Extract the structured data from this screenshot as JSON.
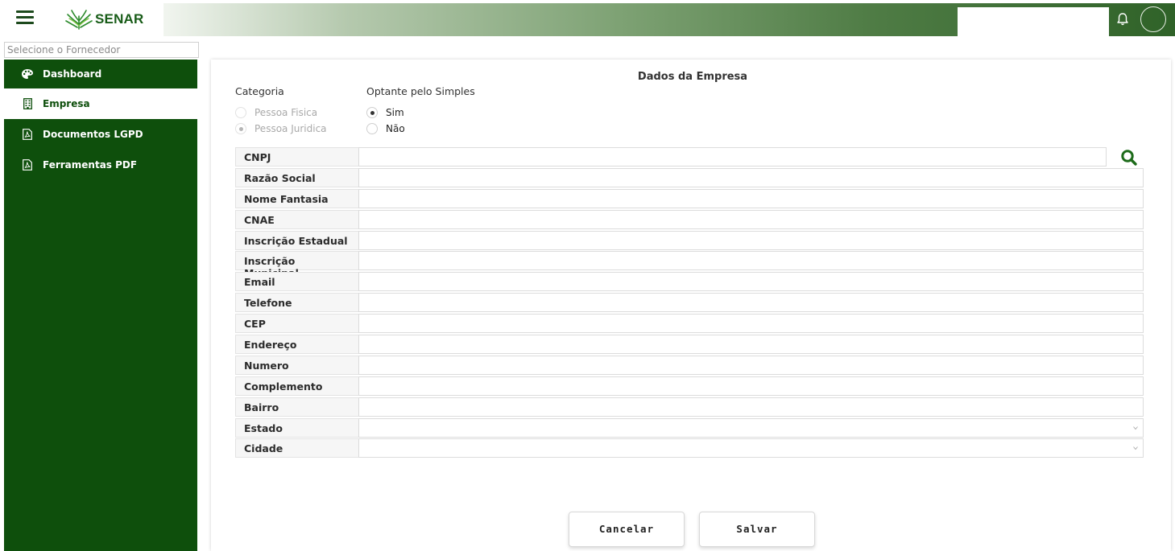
{
  "header": {
    "logo_text": "SENAR",
    "search_value": ""
  },
  "supplier_select": {
    "placeholder": "Selecione o Fornecedor"
  },
  "sidebar": {
    "items": [
      {
        "label": "Dashboard",
        "icon": "palette-icon",
        "active": false
      },
      {
        "label": "Empresa",
        "icon": "building-icon",
        "active": true
      },
      {
        "label": "Documentos LGPD",
        "icon": "pdf-file-icon",
        "active": false
      },
      {
        "label": "Ferramentas PDF",
        "icon": "pdf-file-icon",
        "active": false
      }
    ]
  },
  "main": {
    "title": "Dados da Empresa",
    "categoria": {
      "label": "Categoria",
      "options": [
        "Pessoa Fisica",
        "Pessoa Juridica"
      ],
      "selected": "Pessoa Juridica"
    },
    "simples": {
      "label": "Optante pelo Simples",
      "options": [
        "Sim",
        "Não"
      ],
      "selected": "Sim"
    },
    "fields": [
      {
        "label": "CNPJ",
        "value": ""
      },
      {
        "label": "Razão Social",
        "value": ""
      },
      {
        "label": "Nome Fantasia",
        "value": ""
      },
      {
        "label": "CNAE",
        "value": ""
      },
      {
        "label": "Inscrição Estadual",
        "value": ""
      },
      {
        "label": "Inscrição Municipal",
        "value": ""
      },
      {
        "label": "Email",
        "value": ""
      },
      {
        "label": "Telefone",
        "value": ""
      },
      {
        "label": "CEP",
        "value": ""
      },
      {
        "label": "Endereço",
        "value": ""
      },
      {
        "label": "Numero",
        "value": ""
      },
      {
        "label": "Complemento",
        "value": ""
      },
      {
        "label": "Bairro",
        "value": ""
      },
      {
        "label": "Estado",
        "value": ""
      },
      {
        "label": "Cidade",
        "value": ""
      }
    ],
    "buttons": {
      "cancel": "Cancelar",
      "save": "Salvar"
    }
  },
  "colors": {
    "brand_green": "#0e4f0c",
    "accent_green": "#1d6b1a"
  }
}
